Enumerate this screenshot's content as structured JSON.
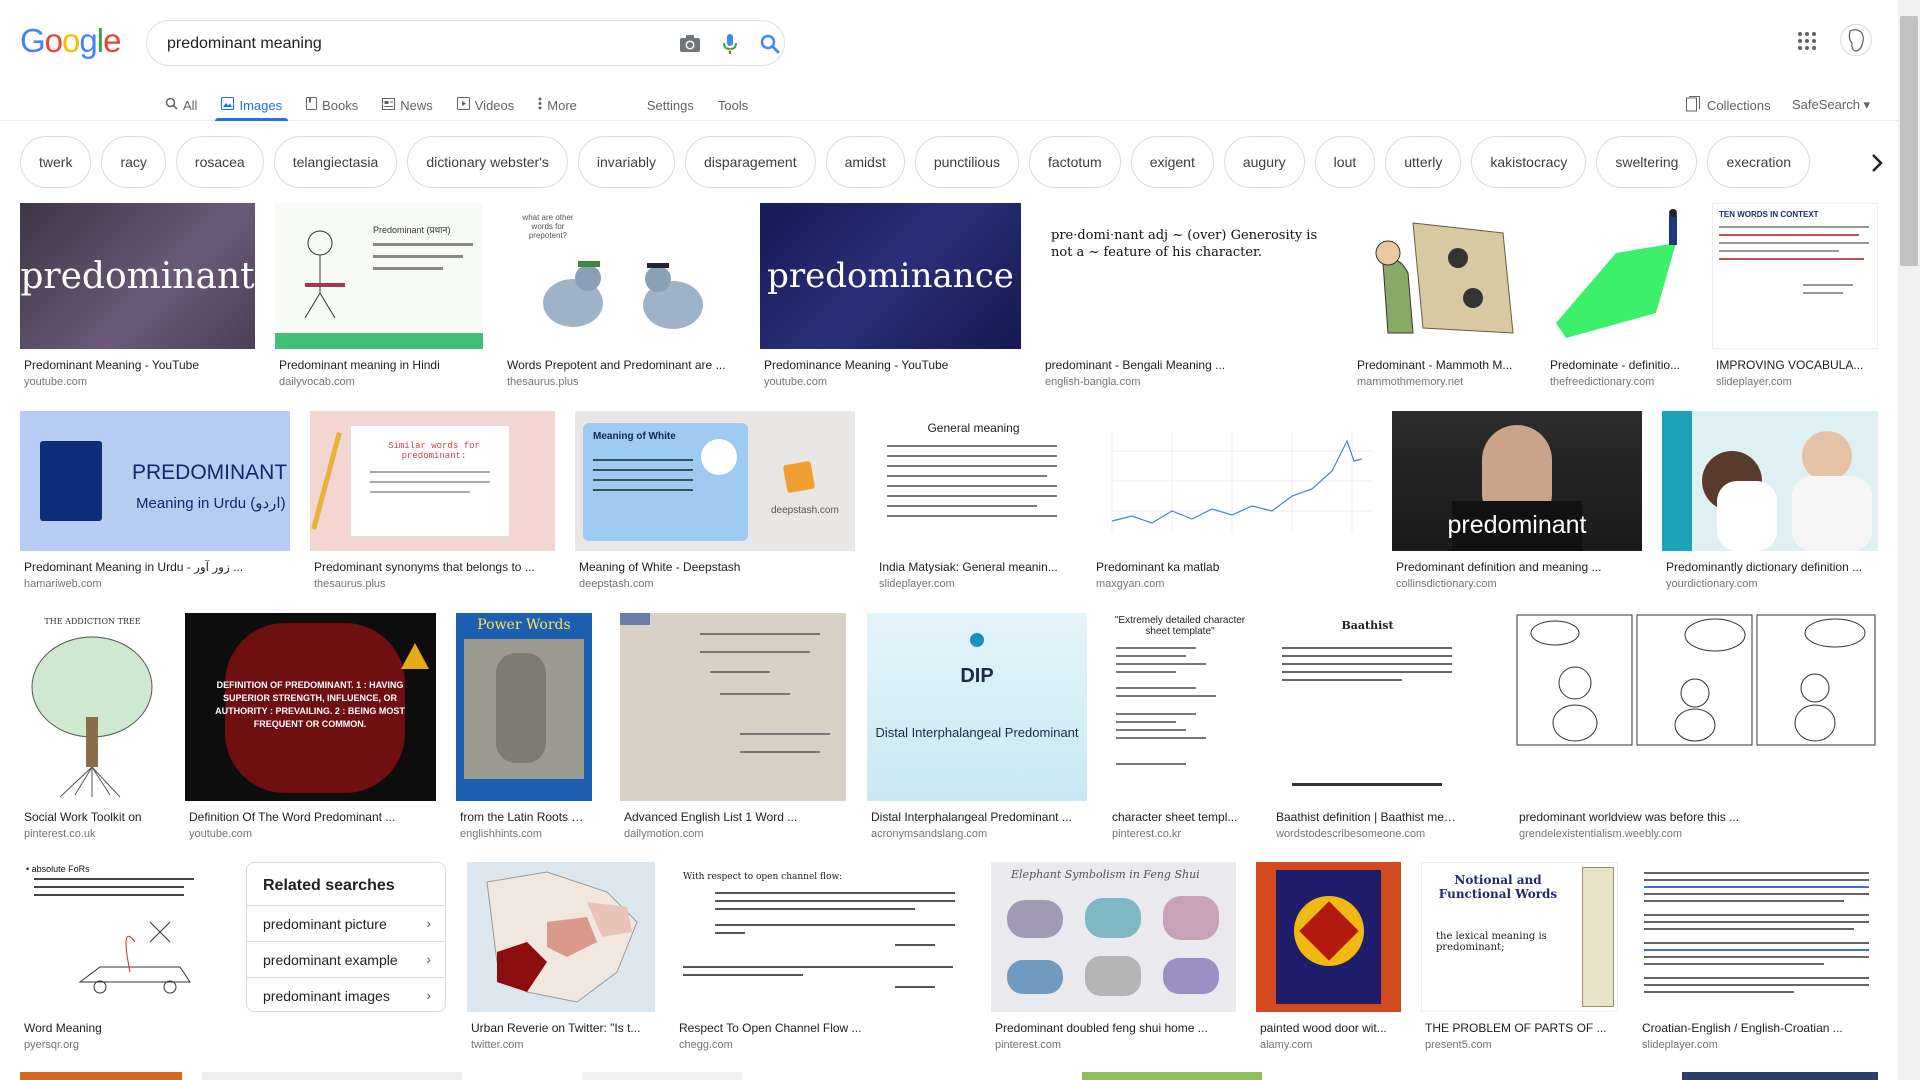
{
  "logo": {
    "letters": [
      "G",
      "o",
      "o",
      "g",
      "l",
      "e"
    ],
    "colors": [
      "#4285F4",
      "#EA4335",
      "#FBBC05",
      "#4285F4",
      "#34A853",
      "#EA4335"
    ]
  },
  "search": {
    "query": "predominant meaning"
  },
  "tabs": [
    {
      "label": "All",
      "icon": "search-icon",
      "active": false
    },
    {
      "label": "Images",
      "icon": "image-icon",
      "active": true
    },
    {
      "label": "Books",
      "icon": "book-icon",
      "active": false
    },
    {
      "label": "News",
      "icon": "news-icon",
      "active": false
    },
    {
      "label": "Videos",
      "icon": "video-icon",
      "active": false
    },
    {
      "label": "More",
      "icon": "more-vert-icon",
      "active": false
    }
  ],
  "tools": {
    "settings": "Settings",
    "tools": "Tools"
  },
  "right": {
    "collections": "Collections",
    "safesearch": "SafeSearch ▾"
  },
  "chips": [
    "twerk",
    "racy",
    "rosacea",
    "telangiectasia",
    "dictionary webster's",
    "invariably",
    "disparagement",
    "amidst",
    "punctilious",
    "factotum",
    "exigent",
    "augury",
    "lout",
    "utterly",
    "kakistocracy",
    "sweltering",
    "execration"
  ],
  "results_row1": [
    {
      "title": "Predominant Meaning - YouTube",
      "source": "youtube.com",
      "thumb_text": "predominant"
    },
    {
      "title": "Predominant meaning in Hindi",
      "source": "dailyvocab.com",
      "thumb_text": "Predominant (प्रधान)"
    },
    {
      "title": "Words Prepotent and Predominant are ...",
      "source": "thesaurus.plus",
      "thumb_text": "what are other words for prepotent?"
    },
    {
      "title": "Predominance Meaning - YouTube",
      "source": "youtube.com",
      "thumb_text": "predominance"
    },
    {
      "title": "predominant - Bengali Meaning ...",
      "source": "english-bangla.com",
      "thumb_text": "pre·domi·nant adj ~ (over) Generosity is not a ~ feature of his character."
    },
    {
      "title": "Predominant - Mammoth M...",
      "source": "mammothmemory.net",
      "thumb_text": ""
    },
    {
      "title": "Predominate - definitio...",
      "source": "thefreedictionary.com",
      "thumb_text": ""
    },
    {
      "title": "IMPROVING VOCABULA...",
      "source": "slideplayer.com",
      "thumb_text": "TEN WORDS IN CONTEXT"
    }
  ],
  "results_row2": [
    {
      "title": "Predominant Meaning in Urdu - زور آور ...",
      "source": "hamariweb.com",
      "thumb_text": "PREDOMINANT",
      "thumb_sub": "Meaning in Urdu (اردو)"
    },
    {
      "title": "Predominant synonyms that belongs to ...",
      "source": "thesaurus.plus",
      "thumb_text": "Similar words for predominant:"
    },
    {
      "title": "Meaning of White - Deepstash",
      "source": "deepstash.com",
      "thumb_text": "Meaning of White",
      "thumb_sub": "deepstash.com"
    },
    {
      "title": "India Matysiak: General meanin...",
      "source": "slideplayer.com",
      "thumb_text": "General meaning"
    },
    {
      "title": "Predominant ka matlab",
      "source": "maxgyan.com",
      "thumb_text": ""
    },
    {
      "title": "Predominant definition and meaning ...",
      "source": "collinsdictionary.com",
      "thumb_text": "predominant"
    },
    {
      "title": "Predominantly dictionary definition ...",
      "source": "yourdictionary.com",
      "thumb_text": ""
    }
  ],
  "results_row3": [
    {
      "title": "Social Work Toolkit on",
      "source": "pinterest.co.uk",
      "thumb_text": "THE ADDICTION TREE"
    },
    {
      "title": "Definition Of The Word Predominant ...",
      "source": "youtube.com",
      "thumb_text": "DEFINITION OF PREDOMINANT. 1 : HAVING SUPERIOR STRENGTH, INFLUENCE, OR AUTHORITY : PREVAILING. 2 : BEING MOST FREQUENT OR COMMON."
    },
    {
      "title": "from the Latin Roots D...",
      "source": "englishhints.com",
      "thumb_text": "Power Words"
    },
    {
      "title": "Advanced English List 1 Word ...",
      "source": "dailymotion.com",
      "thumb_text": ""
    },
    {
      "title": "Distal Interphalangeal Predominant ...",
      "source": "acronymsandslang.com",
      "thumb_text": "DIP",
      "thumb_sub": "Distal Interphalangeal Predominant"
    },
    {
      "title": "character sheet templ...",
      "source": "pinterest.co.kr",
      "thumb_text": "\"Extremely detailed character sheet template\""
    },
    {
      "title": "Baathist definition | Baathist meanin...",
      "source": "wordstodescribesomeone.com",
      "thumb_text": "Baathist"
    },
    {
      "title": "predominant worldview was before this ...",
      "source": "grendelexistentialism.weebly.com",
      "thumb_text": ""
    }
  ],
  "results_row4": [
    {
      "title": "Word Meaning",
      "source": "pyersqr.org",
      "thumb_text": "• absolute FoRs"
    },
    {
      "title": "Urban Reverie on Twitter: \"Is t...",
      "source": "twitter.com",
      "thumb_text": ""
    },
    {
      "title": "Respect To Open Channel Flow ...",
      "source": "chegg.com",
      "thumb_text": "With respect to open channel flow:"
    },
    {
      "title": "Predominant doubled feng shui home ...",
      "source": "pinterest.com",
      "thumb_text": "Elephant Symbolism in Feng Shui"
    },
    {
      "title": "painted wood door wit...",
      "source": "alamy.com",
      "thumb_text": ""
    },
    {
      "title": "THE PROBLEM OF PARTS OF ...",
      "source": "present5.com",
      "thumb_text": "Notional and Functional Words",
      "thumb_sub": "the lexical meaning is predominant;"
    },
    {
      "title": "Croatian-English / English-Croatian ...",
      "source": "slideplayer.com",
      "thumb_text": ""
    }
  ],
  "related": {
    "title": "Related searches",
    "items": [
      "predominant picture",
      "predominant example",
      "predominant images"
    ]
  }
}
